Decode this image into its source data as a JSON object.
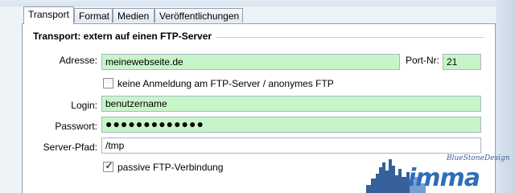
{
  "tabs": [
    {
      "label": "Transport",
      "active": true
    },
    {
      "label": "Format",
      "active": false
    },
    {
      "label": "Medien",
      "active": false
    },
    {
      "label": "Veröffentlichungen",
      "active": false
    }
  ],
  "group": {
    "title": "Transport: extern auf einen FTP-Server"
  },
  "address": {
    "label": "Adresse:",
    "value": "meinewebseite.de"
  },
  "port": {
    "label": "Port-Nr:",
    "value": "21"
  },
  "no_login": {
    "label": "keine Anmeldung am FTP-Server / anonymes FTP",
    "checked": false
  },
  "login": {
    "label": "Login:",
    "value": "benutzername"
  },
  "password": {
    "label": "Passwort:",
    "value": "●●●●●●●●●●●●●"
  },
  "server_path": {
    "label": "Server-Pfad:",
    "value": "/tmp"
  },
  "passive_ftp": {
    "label": "passive FTP-Verbindung",
    "checked": true
  },
  "watermark": {
    "word": "imma",
    "tagline": "BlueStoneDesign"
  },
  "colors": {
    "filled_field": "#c8f5c8",
    "border": "#8e9fb4",
    "accent": "#2f6eb8"
  },
  "icons": {
    "checkbox_checked": "check-mark"
  }
}
